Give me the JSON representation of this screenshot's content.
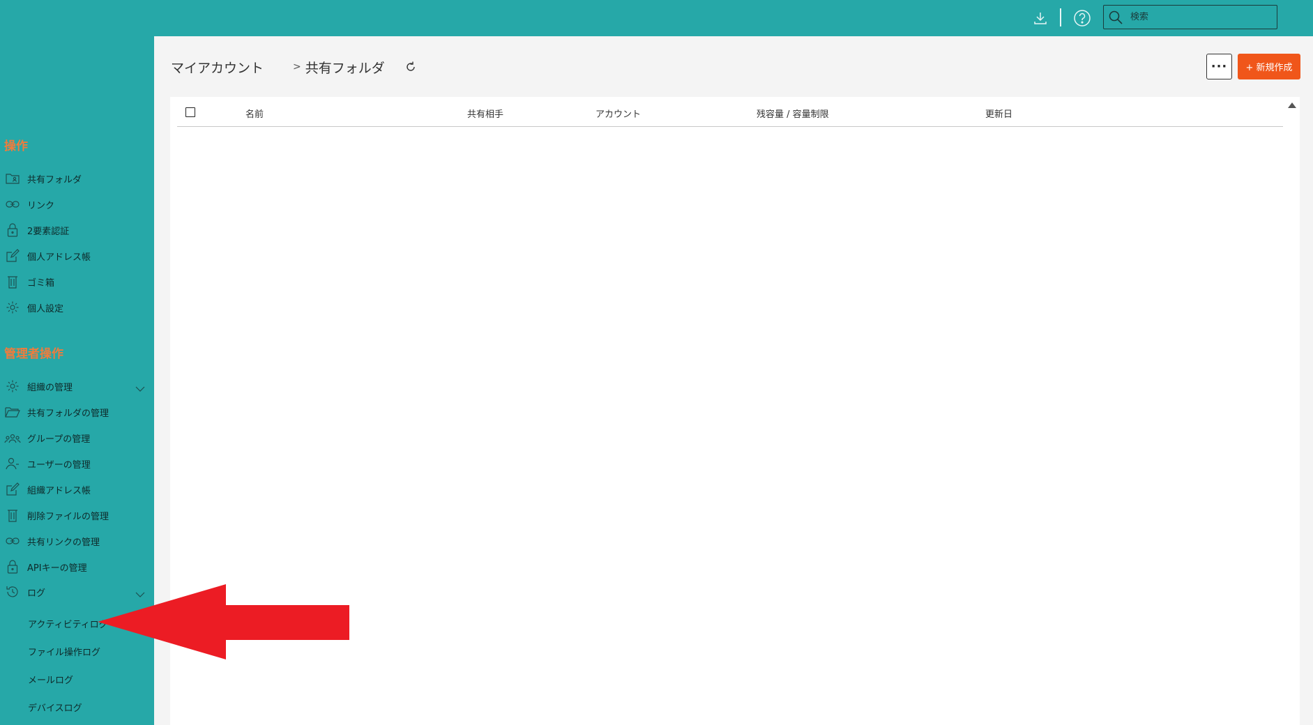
{
  "topbar": {
    "search_placeholder": "検索",
    "icons": [
      "download-icon",
      "help-icon",
      "search-icon"
    ]
  },
  "sidebar": {
    "ops_heading": "操作",
    "ops_items": [
      {
        "label": "共有フォルダ",
        "icon": "shared-folder-icon"
      },
      {
        "label": "リンク",
        "icon": "link-icon"
      },
      {
        "label": "2要素認証",
        "icon": "lock-icon"
      },
      {
        "label": "個人アドレス帳",
        "icon": "edit-icon"
      },
      {
        "label": "ゴミ箱",
        "icon": "trash-icon"
      },
      {
        "label": "個人設定",
        "icon": "gear-icon"
      }
    ],
    "admin_heading": "管理者操作",
    "admin_items": [
      {
        "label": "組織の管理",
        "icon": "gear-icon"
      },
      {
        "label": "共有フォルダの管理",
        "icon": "folder-open-icon"
      },
      {
        "label": "グループの管理",
        "icon": "group-icon"
      },
      {
        "label": "ユーザーの管理",
        "icon": "user-icon"
      },
      {
        "label": "組織アドレス帳",
        "icon": "edit-icon"
      },
      {
        "label": "削除ファイルの管理",
        "icon": "trash-icon"
      },
      {
        "label": "共有リンクの管理",
        "icon": "link-icon"
      },
      {
        "label": "APIキーの管理",
        "icon": "lock-icon"
      },
      {
        "label": "ログ",
        "icon": "history-icon"
      }
    ],
    "log_items": [
      "アクティビティログ",
      "ファイル操作ログ",
      "メールログ",
      "デバイスログ"
    ]
  },
  "main": {
    "breadcrumb": {
      "root": "マイアカウント",
      "separator": ">",
      "current": "共有フォルダ"
    },
    "more_label": "···",
    "new_button_label": "+ 新規作成",
    "table": {
      "columns": [
        "名前",
        "共有相手",
        "アカウント",
        "残容量 / 容量制限",
        "更新日"
      ],
      "rows": []
    }
  },
  "colors": {
    "teal": "#26a8a8",
    "accent_orange": "#f0561a",
    "heading_orange": "#f07c3c",
    "annotation_red": "#ec1c24"
  }
}
